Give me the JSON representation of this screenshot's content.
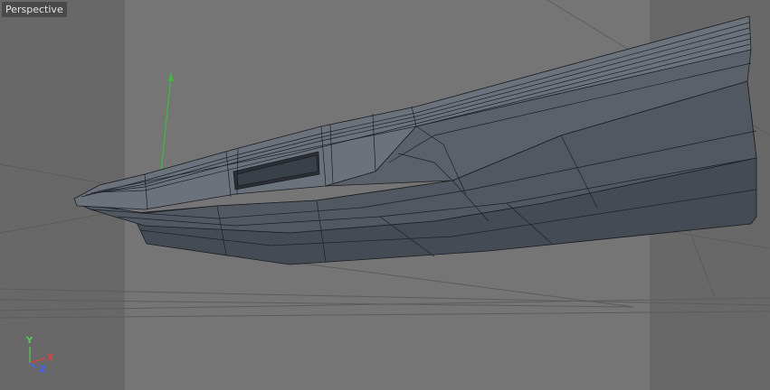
{
  "viewport": {
    "label": "Perspective"
  },
  "axes": {
    "x_label": "X",
    "y_label": "Y",
    "z_label": "Z",
    "x_color": "#e04040",
    "y_color": "#4fd04f",
    "z_color": "#4060ff"
  },
  "colors": {
    "background": "#6f6f6f",
    "mesh_fill": "#4b525c",
    "mesh_wire": "#1a1d22",
    "grid": "#585858"
  }
}
